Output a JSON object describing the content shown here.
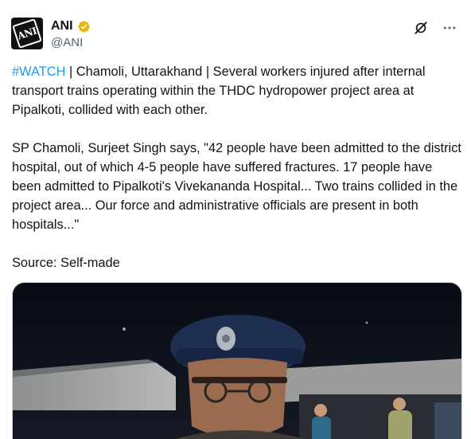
{
  "author": {
    "display_name": "ANI",
    "handle": "@ANI",
    "avatar_text": "ANI",
    "verified_color": "#e2b719"
  },
  "actions": {
    "grok_icon": "grok-icon",
    "more_icon": "more-icon"
  },
  "tweet": {
    "hashtag": "#WATCH",
    "text_1": " | Chamoli, Uttarakhand | Several workers injured after internal transport trains operating within the THDC hydropower project area at Pipalkoti, collided with each other.",
    "text_2": "SP Chamoli, Surjeet Singh says, \"42 people have been admitted to the district hospital, out of which 4-5 people have suffered fractures. 17 people have been admitted to Pipalkoti's Vivekananda Hospital... Two trains collided in the project area... Our force and administrative officials are present in both hospitals...\"",
    "text_3": "Source: Self-made"
  },
  "colors": {
    "link": "#1d9bf0",
    "text": "#0f1419",
    "secondary": "#536471"
  }
}
